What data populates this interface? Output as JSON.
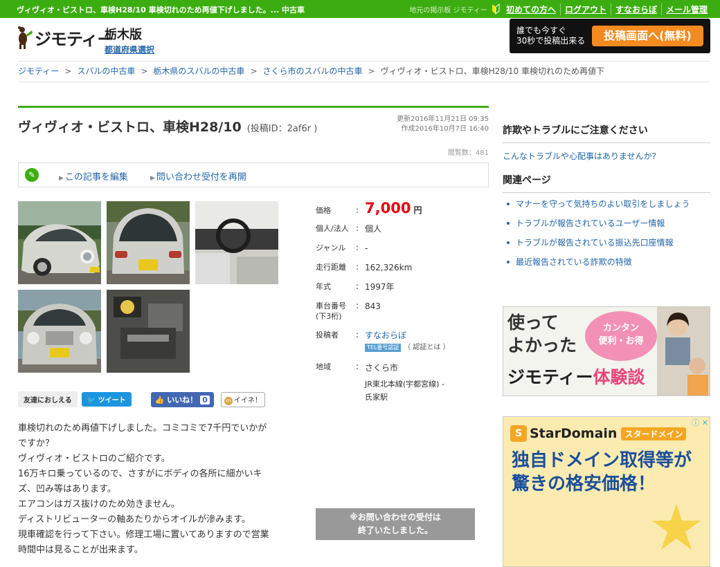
{
  "topbar": {
    "announcement": "ヴィヴィオ・ビストロ、車検H28/10 車検切れのため再値下げしました。... 中古車",
    "board_label": "地元の掲示板 ジモティー",
    "nav": [
      "初めての方へ",
      "ログアウト",
      "すなおらぼ",
      "メール管理"
    ]
  },
  "header": {
    "logo_text": "ジモティー",
    "prefecture": "栃木版",
    "prefecture_select": "都道府県選択",
    "post_box": {
      "line1": "誰でも今すぐ",
      "line2": "30秒で投稿出来る",
      "button": "投稿画面へ(無料)"
    }
  },
  "breadcrumb": {
    "separator": ">",
    "items": [
      "ジモティー",
      "スバルの中古車",
      "栃木県のスバルの中古車",
      "さくら市のスバルの中古車"
    ],
    "current": "ヴィヴィオ・ビストロ、車検H28/10 車検切れのため再値下"
  },
  "post": {
    "title": "ヴィヴィオ・ビストロ、車検H28/10",
    "post_id": "(投稿ID：2af6r )",
    "updated": "更新2016年11月21日 09:35",
    "created": "作成2016年10月7日 16:40",
    "views": "閲覧数：481",
    "edit_link": "この記事を編集",
    "resume_link": "問い合わせ受付を再開"
  },
  "photos": [
    {
      "name": "front-side-view"
    },
    {
      "name": "rear-view"
    },
    {
      "name": "interior-view"
    },
    {
      "name": "front-view"
    },
    {
      "name": "engine-view"
    }
  ],
  "share": {
    "label": "友達におしえる",
    "tweet": "ツイート",
    "like": "いいね！",
    "like_count": "0",
    "mixi": "イイネ！"
  },
  "description": [
    "車検切れのため再値下げしました。コミコミで7千円でいかが",
    "ですか？",
    "ヴィヴィオ・ビストロのご紹介です。",
    "16万キロ乗っているので、さすがにボディの各所に細かいキ",
    "ズ、凹み等はあります。",
    "エアコンはガス抜けのため効きません。",
    "ディストリビューターの軸あたりからオイルが滲みます。",
    "現車確認を行って下さい。修理工場に置いてありますので営業",
    "時間中は見ることが出来ます。"
  ],
  "info": {
    "colon": ":",
    "price_label": "価格",
    "price": "7,000",
    "yen": "円",
    "type_label": "個人/法人",
    "type": "個人",
    "genre_label": "ジャンル",
    "genre": "-",
    "mileage_label": "走行距離",
    "mileage": "162,326km",
    "year_label": "年式",
    "year": "1997年",
    "chassis_label_1": "車台番号",
    "chassis_label_2": "(下3桁)",
    "chassis": "843",
    "poster_label": "投稿者",
    "poster": "すなおらぼ",
    "poster_badge": "TEL番号認証",
    "poster_auth": "（ 認証とは ）",
    "area_label": "地域",
    "area": "さくら市",
    "station_1": "JR東北本線(宇都宮線) -",
    "station_2": "氏家駅",
    "closed_1": "※お問い合わせの受付は",
    "closed_2": "終了いたしました。"
  },
  "sidebar": {
    "warning_title": "詐欺やトラブルにご注意ください",
    "warning_link": "こんなトラブルや心配事はありませんか?",
    "related_title": "関連ページ",
    "related": [
      "マナーを守って気持ちのよい取引をしましょう",
      "トラブルが報告されているユーザー情報",
      "トラブルが報告されている振込先口座情報",
      "最近報告されている詐欺の特徴"
    ]
  },
  "ads": {
    "banner1": {
      "line1": "使って",
      "line2": "よかった",
      "bubble1": "カンタン",
      "bubble2": "便利・お得",
      "brand": "ジモティー",
      "brand_suffix": "体験談"
    },
    "banner2": {
      "brand": "StarDomain",
      "brand_kana": "スタードメイン",
      "line1": "独自ドメイン取得等が",
      "line2": "驚きの格安価格！"
    }
  },
  "colors": {
    "brand_green": "#3cad11",
    "price_red": "#e60012",
    "link_blue": "#2266aa",
    "cta_orange": "#f58a1f"
  }
}
